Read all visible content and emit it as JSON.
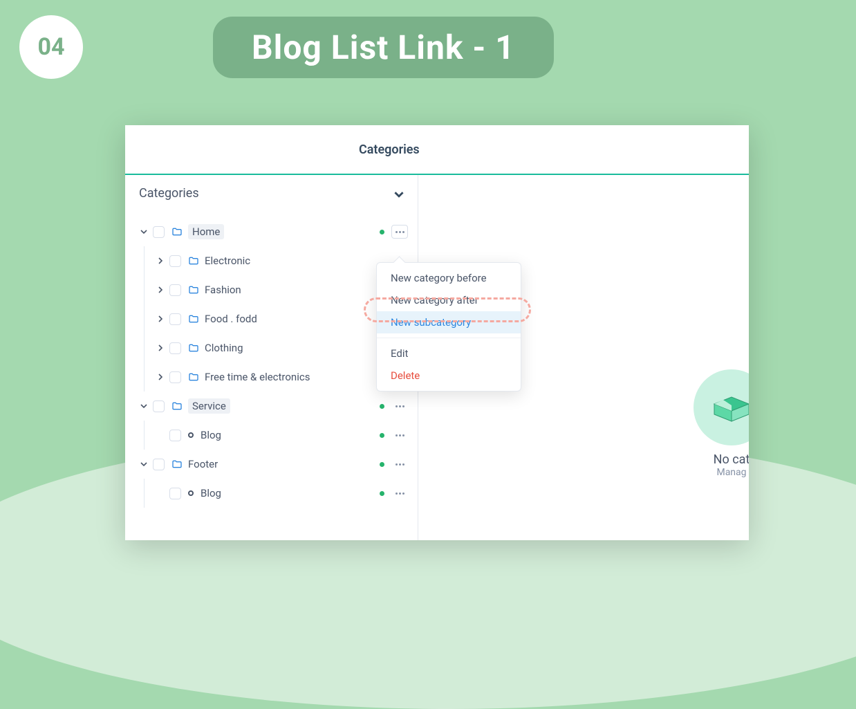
{
  "step": "04",
  "title": "Blog List Link - 1",
  "tab": "Categories",
  "panel": {
    "title": "Categories"
  },
  "tree": {
    "home": "Home",
    "electronic": "Electronic",
    "fashion": "Fashion",
    "food": "Food . fodd",
    "clothing": "Clothing",
    "freetime": "Free time & electronics",
    "service": "Service",
    "blog1": "Blog",
    "footer": "Footer",
    "blog2": "Blog"
  },
  "menu": {
    "before": "New category before",
    "after": "New category after",
    "sub": "New subcategory",
    "edit": "Edit",
    "delete": "Delete"
  },
  "empty": {
    "title": "No cat",
    "sub": "Manag"
  }
}
